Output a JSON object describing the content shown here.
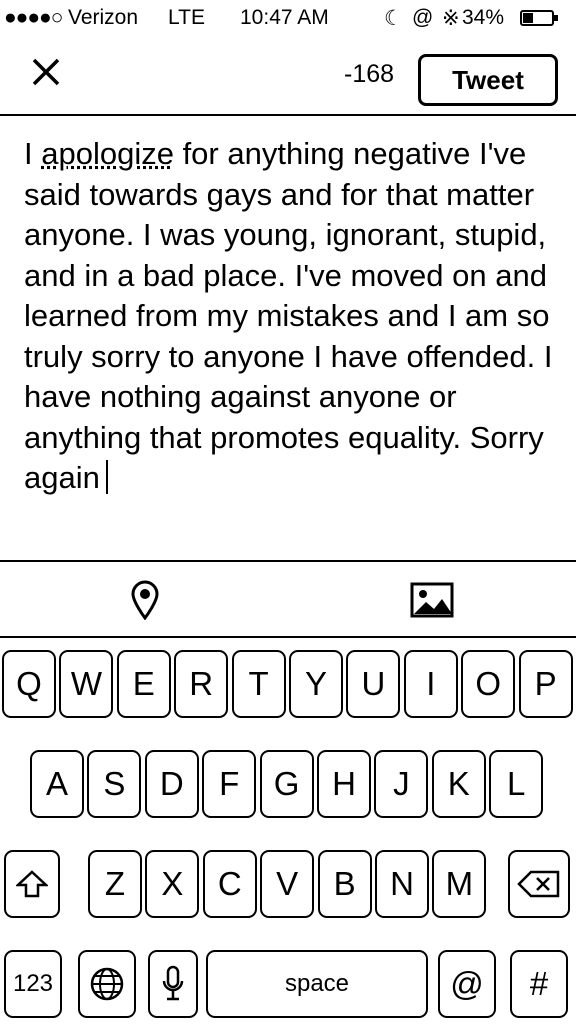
{
  "status_bar": {
    "signal": "●●●●○",
    "carrier": "Verizon",
    "network": "LTE",
    "time": "10:47 AM",
    "battery_percent": "34%",
    "battery_level": 0.34
  },
  "compose": {
    "char_count": "-168",
    "tweet_label": "Tweet",
    "text_underlined_word": "apologize",
    "text_before": "I ",
    "text_after": " for anything negative I've said towards gays and for that matter anyone. I was young, ignorant, stupid, and in a bad place. I've moved on and learned from my mistakes and I am so truly sorry to anyone I have offended. I have nothing against anyone or anything that promotes equality. Sorry again"
  },
  "icons": {
    "close": "close-icon",
    "location": "location-pin-icon",
    "photo": "photo-icon",
    "shift": "shift-icon",
    "backspace": "backspace-icon",
    "globe": "globe-icon",
    "microphone": "microphone-icon"
  },
  "keyboard": {
    "row1": [
      "Q",
      "W",
      "E",
      "R",
      "T",
      "Y",
      "U",
      "I",
      "O",
      "P"
    ],
    "row2": [
      "A",
      "S",
      "D",
      "F",
      "G",
      "H",
      "J",
      "K",
      "L"
    ],
    "row3": [
      "Z",
      "X",
      "C",
      "V",
      "B",
      "N",
      "M"
    ],
    "numbers_label": "123",
    "space_label": "space",
    "at_label": "@",
    "hash_label": "#"
  }
}
